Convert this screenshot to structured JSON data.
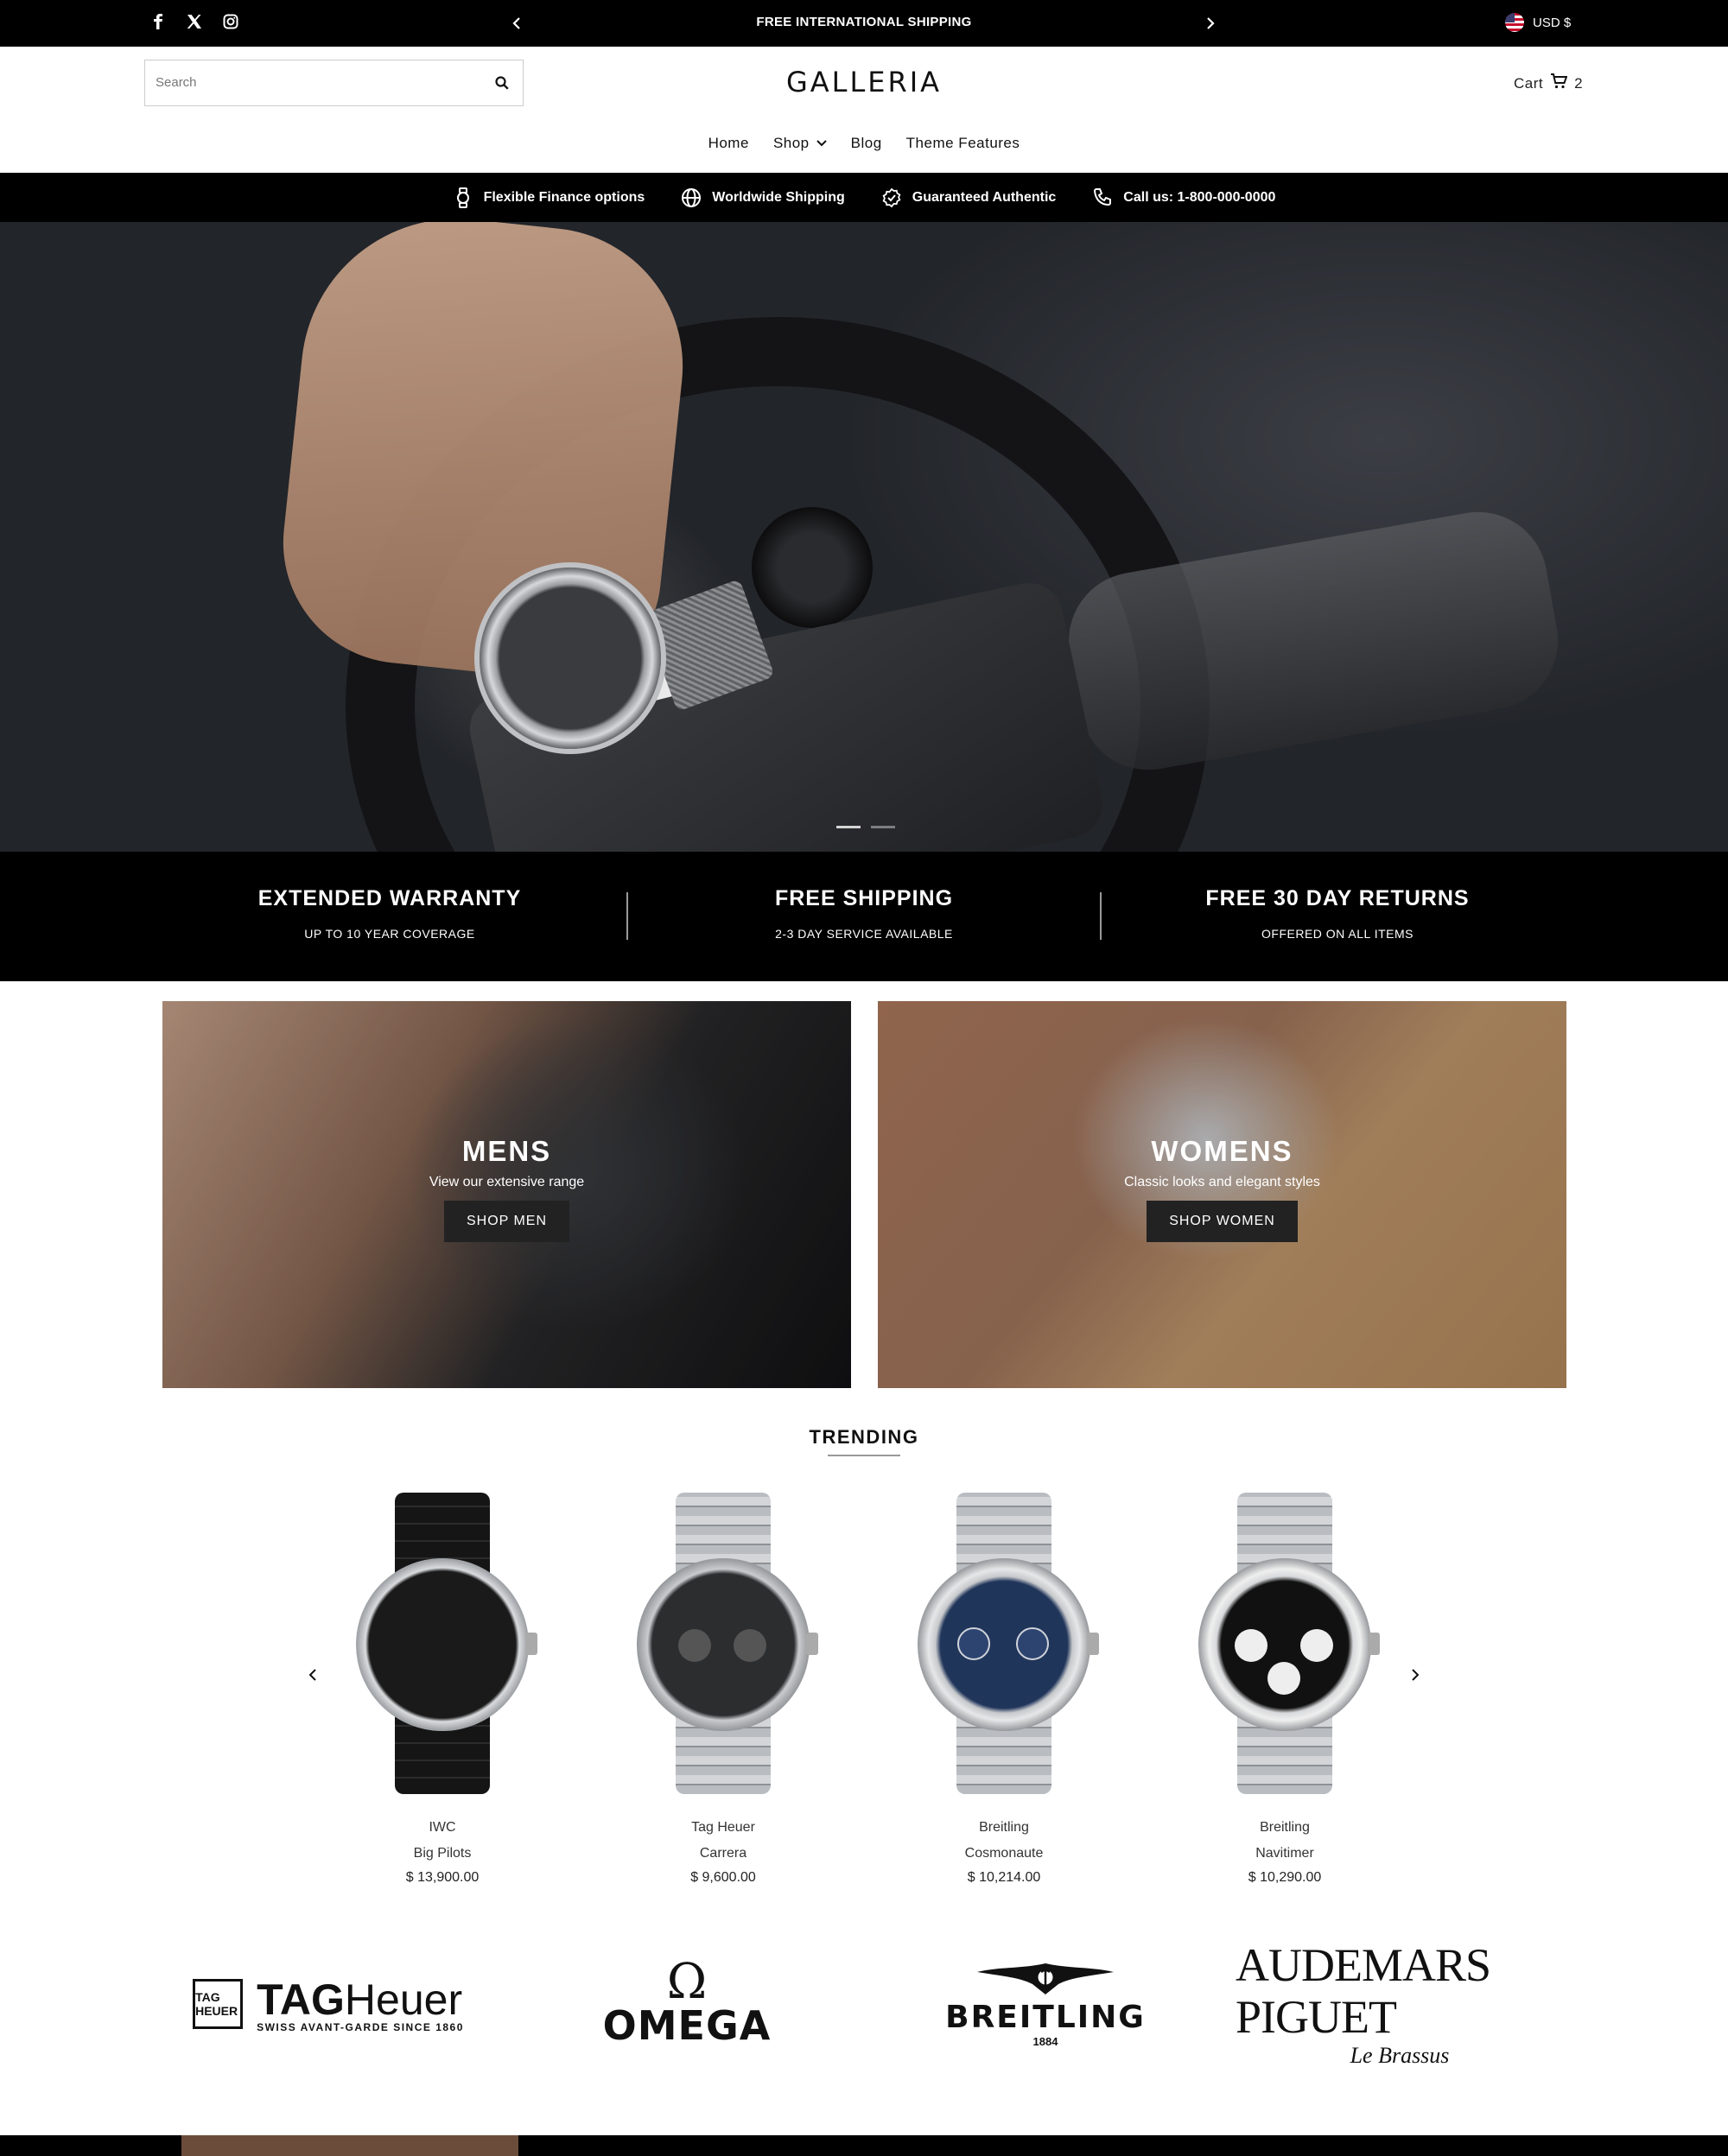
{
  "announcement": {
    "message": "FREE INTERNATIONAL SHIPPING",
    "currency": "USD $",
    "socials": [
      "facebook-icon",
      "x-icon",
      "instagram-icon"
    ]
  },
  "header": {
    "search_placeholder": "Search",
    "logo": "GALLERIA",
    "cart_label": "Cart",
    "cart_count": "2"
  },
  "nav": {
    "items": [
      {
        "label": "Home"
      },
      {
        "label": "Shop"
      },
      {
        "label": "Blog"
      },
      {
        "label": "Theme Features"
      }
    ]
  },
  "features": [
    {
      "label": "Flexible Finance options",
      "icon": "watch-icon"
    },
    {
      "label": "Worldwide Shipping",
      "icon": "globe-icon"
    },
    {
      "label": "Guaranteed Authentic",
      "icon": "badge-check-icon"
    },
    {
      "label": "Call us: 1-800-000-0000",
      "icon": "phone-icon"
    }
  ],
  "hero": {
    "slides": 2,
    "active_slide": 1
  },
  "benefits": [
    {
      "title": "EXTENDED WARRANTY",
      "subtitle": "UP TO 10 YEAR COVERAGE"
    },
    {
      "title": "FREE SHIPPING",
      "subtitle": "2-3 DAY SERVICE AVAILABLE"
    },
    {
      "title": "FREE 30 DAY RETURNS",
      "subtitle": "OFFERED ON ALL ITEMS"
    }
  ],
  "categories": {
    "mens": {
      "title": "MENS",
      "subtitle": "View our extensive range",
      "button": "SHOP MEN"
    },
    "womens": {
      "title": "WOMENS",
      "subtitle": "Classic looks and elegant styles",
      "button": "SHOP WOMEN"
    }
  },
  "trending": {
    "title": "TRENDING",
    "products": [
      {
        "brand": "IWC",
        "model": "Big Pilots",
        "price": "$ 13,900.00"
      },
      {
        "brand": "Tag Heuer",
        "model": "Carrera",
        "price": "$ 9,600.00"
      },
      {
        "brand": "Breitling",
        "model": "Cosmonaute",
        "price": "$ 10,214.00"
      },
      {
        "brand": "Breitling",
        "model": "Navitimer",
        "price": "$ 10,290.00"
      }
    ]
  },
  "brands": {
    "tag": {
      "box": "TAG HEUER",
      "name_bold": "TAG",
      "name_light": "Heuer",
      "tagline": "SWISS AVANT-GARDE SINCE 1860"
    },
    "omega": {
      "symbol": "Ω",
      "name": "OMEGA"
    },
    "breitling": {
      "name": "BREITLING",
      "year": "1884"
    },
    "ap": {
      "name": "AUDEMARS PIGUET",
      "sub": "Le Brassus"
    }
  },
  "colors": {
    "black": "#000000",
    "white": "#ffffff",
    "button": "#222222"
  }
}
